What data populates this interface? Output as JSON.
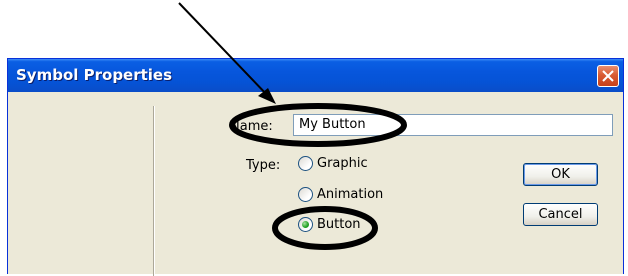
{
  "window": {
    "title": "Symbol Properties"
  },
  "form": {
    "name_label": "Name:",
    "name_value": "My Button",
    "type_label": "Type:",
    "type_options": [
      {
        "label": "Graphic",
        "selected": false
      },
      {
        "label": "Animation",
        "selected": false
      },
      {
        "label": "Button",
        "selected": true
      }
    ]
  },
  "buttons": {
    "ok_label": "OK",
    "cancel_label": "Cancel"
  },
  "colors": {
    "titlebar": "#0553d6",
    "dialog_bg": "#ece9d8",
    "close_button": "#d95b33",
    "annotation": "#000000"
  },
  "icons": {
    "close": "close-icon",
    "annotation_arrow": "arrow-icon"
  }
}
